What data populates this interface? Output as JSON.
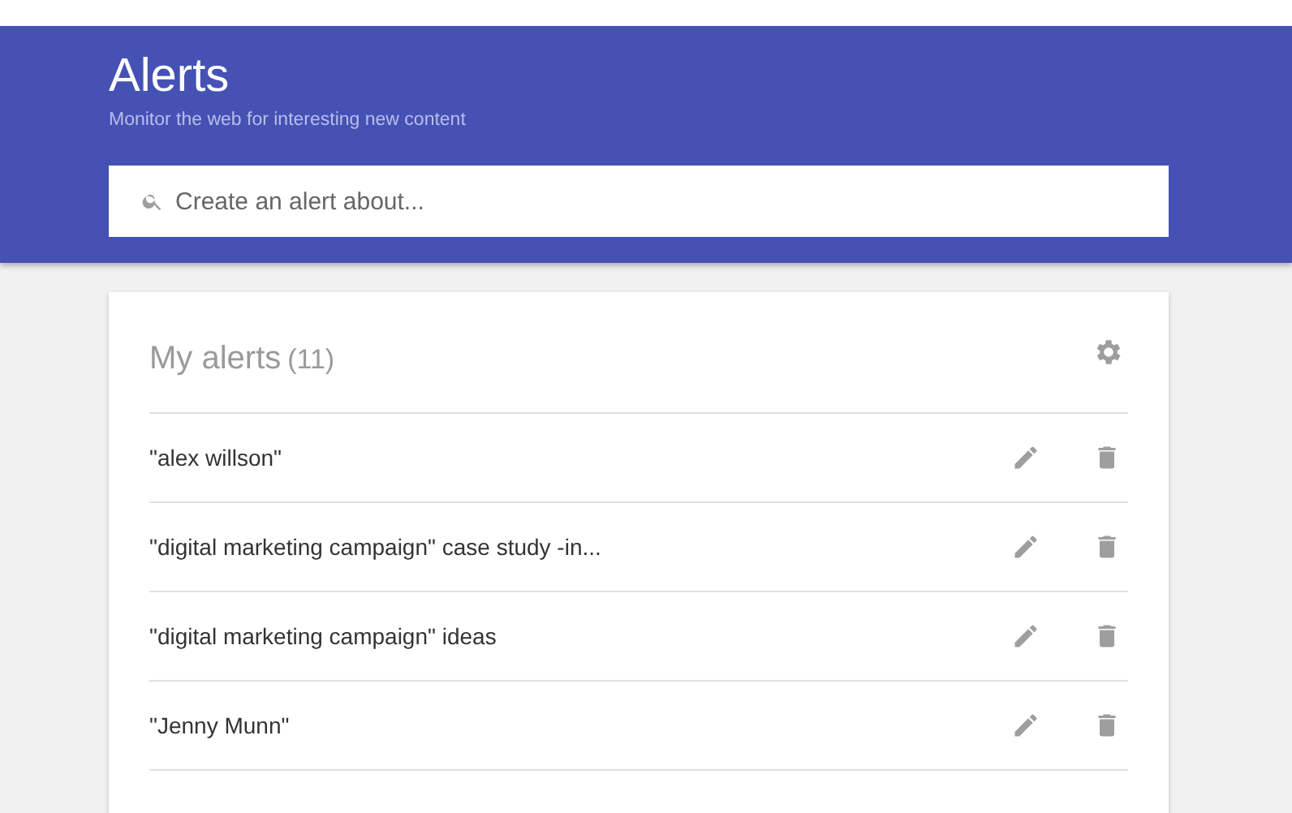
{
  "header": {
    "title": "Alerts",
    "subtitle": "Monitor the web for interesting new content"
  },
  "search": {
    "placeholder": "Create an alert about..."
  },
  "alerts_card": {
    "title": "My alerts",
    "count": "(11)",
    "items": [
      {
        "query": "\"alex willson\""
      },
      {
        "query": "\"digital marketing campaign\" case study -in..."
      },
      {
        "query": "\"digital marketing campaign\" ideas"
      },
      {
        "query": "\"Jenny Munn\""
      }
    ]
  }
}
